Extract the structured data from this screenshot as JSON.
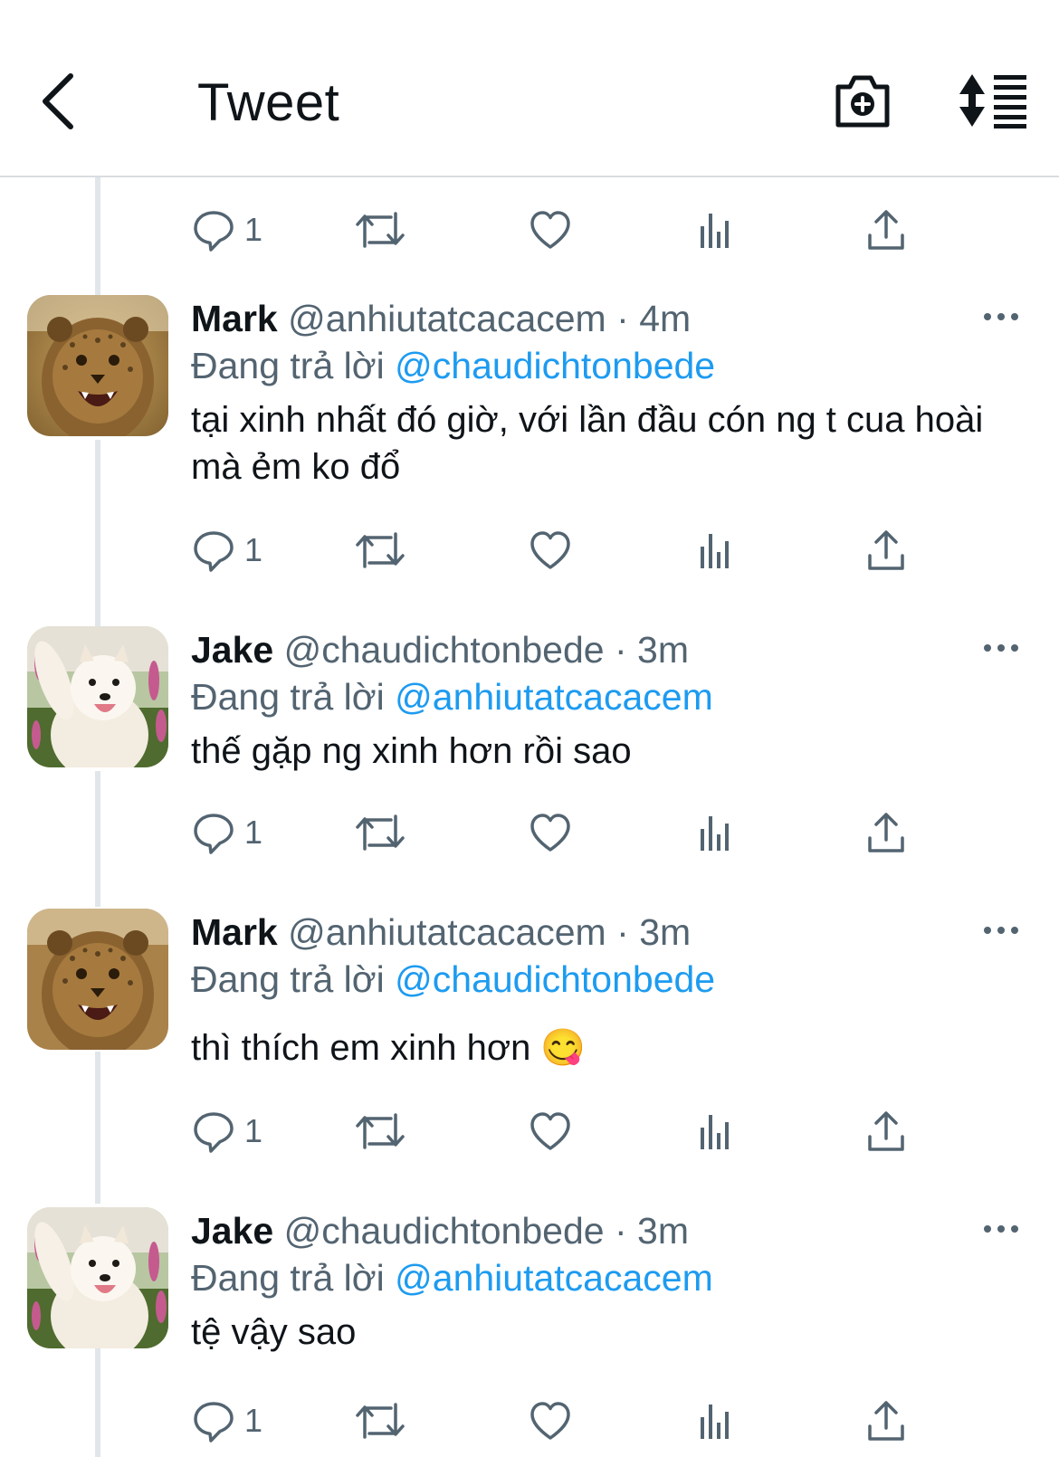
{
  "header": {
    "title": "Tweet",
    "back_icon": "chevron-left-icon",
    "camera_icon": "camera-plus-icon",
    "sort_icon": "sort-list-icon"
  },
  "colors": {
    "text": "#0f1419",
    "secondary": "#536471",
    "mention": "#1d9bf0",
    "thread_line": "#e1e6ea"
  },
  "top_actions": {
    "reply_count": "1"
  },
  "tweets": [
    {
      "name": "Mark",
      "handle": "@anhiutatcacacem",
      "time": "4m",
      "reply_prefix": "Đang trả lời",
      "reply_to": "@chaudichtonbede",
      "text": "tại xinh nhất đó giờ, với lần đầu cón ng t cua hoài mà ẻm ko đổ",
      "reply_count": "1",
      "avatar": "cheetah-cub-avatar"
    },
    {
      "name": "Jake",
      "handle": "@chaudichtonbede",
      "time": "3m",
      "reply_prefix": "Đang trả lời",
      "reply_to": "@anhiutatcacacem",
      "text": "thế gặp ng xinh hơn rồi sao",
      "reply_count": "1",
      "avatar": "samoyed-dog-avatar"
    },
    {
      "name": "Mark",
      "handle": "@anhiutatcacacem",
      "time": "3m",
      "reply_prefix": "Đang trả lời",
      "reply_to": "@chaudichtonbede",
      "text": "thì thích em xinh hơn 😋",
      "reply_count": "1",
      "avatar": "cheetah-cub-avatar"
    },
    {
      "name": "Jake",
      "handle": "@chaudichtonbede",
      "time": "3m",
      "reply_prefix": "Đang trả lời",
      "reply_to": "@anhiutatcacacem",
      "text": "tệ vậy sao",
      "reply_count": "1",
      "avatar": "samoyed-dog-avatar"
    }
  ]
}
